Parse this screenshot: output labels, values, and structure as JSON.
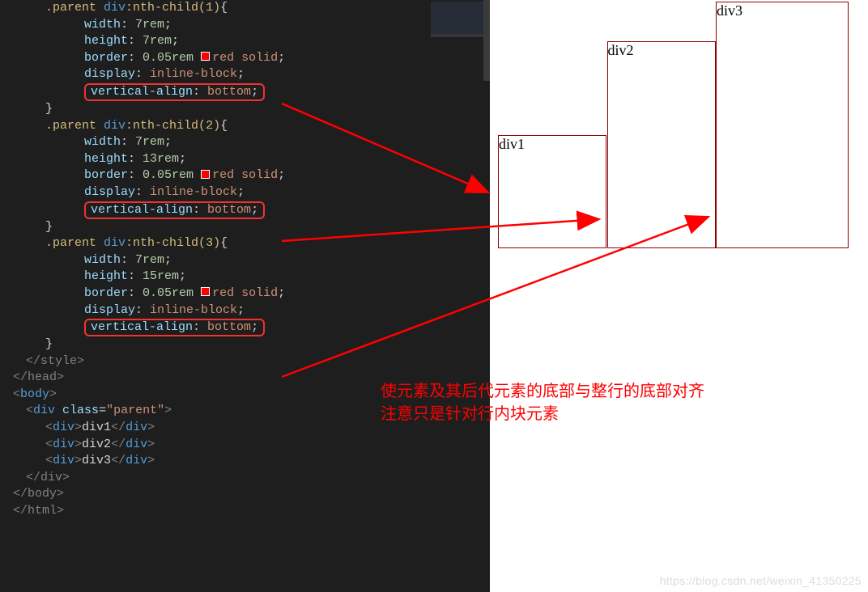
{
  "code": {
    "rules": [
      {
        "sel": ".parent div:nth-child(1)",
        "decls": [
          [
            "width",
            "7rem"
          ],
          [
            "height",
            "7rem"
          ],
          [
            "border",
            "0.05rem",
            "red solid",
            true
          ],
          [
            "display",
            "inline-block"
          ],
          [
            "vertical-align",
            "bottom"
          ]
        ]
      },
      {
        "sel": ".parent div:nth-child(2)",
        "decls": [
          [
            "width",
            "7rem"
          ],
          [
            "height",
            "13rem"
          ],
          [
            "border",
            "0.05rem",
            "red solid",
            true
          ],
          [
            "display",
            "inline-block"
          ],
          [
            "vertical-align",
            "bottom"
          ]
        ]
      },
      {
        "sel": ".parent div:nth-child(3)",
        "decls": [
          [
            "width",
            "7rem"
          ],
          [
            "height",
            "15rem"
          ],
          [
            "border",
            "0.05rem",
            "red solid",
            true
          ],
          [
            "display",
            "inline-block"
          ],
          [
            "vertical-align",
            "bottom"
          ]
        ]
      }
    ],
    "closeStyle": "</style>",
    "closeHead": "</head>",
    "openBody": "<body>",
    "parentOpen": {
      "tag": "div",
      "attr": "class",
      "val": "parent"
    },
    "children": [
      {
        "tag": "div",
        "text": "div1"
      },
      {
        "tag": "div",
        "text": "div2"
      },
      {
        "tag": "div",
        "text": "div3"
      }
    ],
    "closeDiv": "</div>",
    "closeBody": "</body>",
    "closeHtml": "</html>"
  },
  "preview": {
    "b1": "div1",
    "b2": "div2",
    "b3": "div3"
  },
  "note": {
    "l1": "使元素及其后代元素的底部与整行的底部对齐",
    "l2": "注意只是针对行内块元素"
  },
  "watermark": "https://blog.csdn.net/weixin_41350225"
}
